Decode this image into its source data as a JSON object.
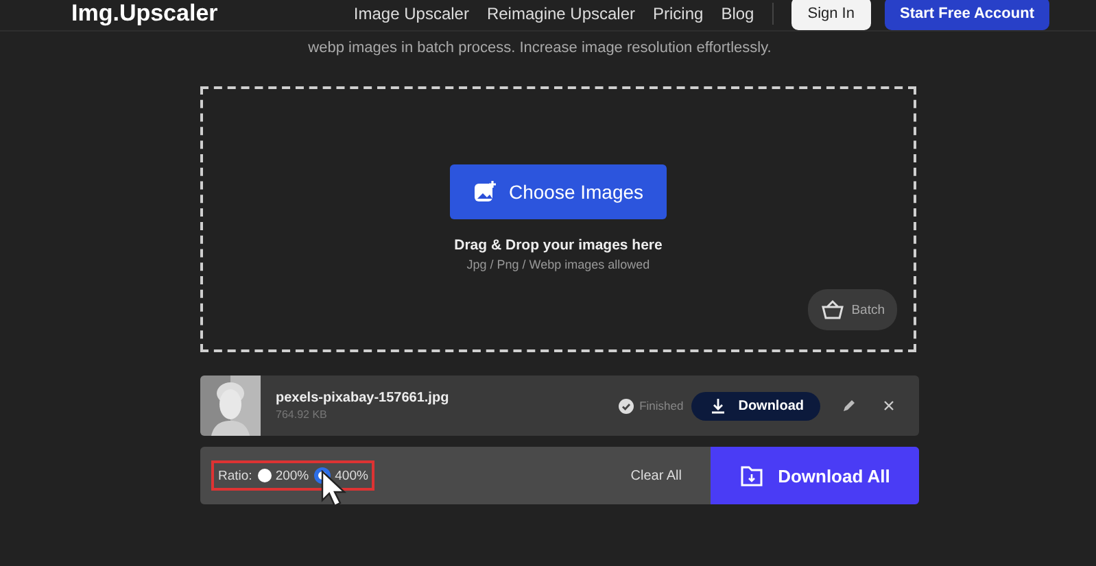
{
  "header": {
    "logo": "Img.Upscaler",
    "nav": [
      "Image Upscaler",
      "Reimagine Upscaler",
      "Pricing",
      "Blog"
    ],
    "sign_in": "Sign In",
    "start": "Start Free Account"
  },
  "subtitle": "webp images in batch process. Increase image resolution effortlessly.",
  "dropzone": {
    "button": "Choose Images",
    "title": "Drag & Drop your images here",
    "hint": "Jpg / Png / Webp images allowed",
    "batch": "Batch"
  },
  "file": {
    "name": "pexels-pixabay-157661.jpg",
    "size": "764.92 KB",
    "status": "Finished",
    "download": "Download"
  },
  "footer": {
    "ratio_label": "Ratio:",
    "ratios": [
      {
        "label": "200%",
        "selected": false
      },
      {
        "label": "400%",
        "selected": true
      }
    ],
    "clear": "Clear All",
    "download_all": "Download All"
  }
}
